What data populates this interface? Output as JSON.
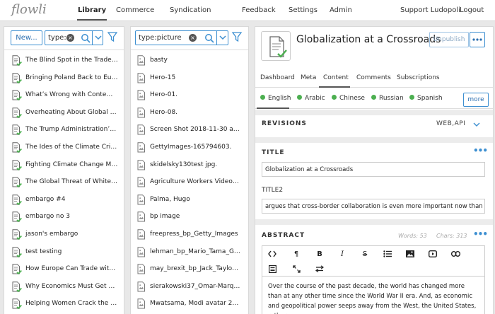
{
  "app": {
    "logo": "flowli"
  },
  "nav": {
    "items": [
      "Library",
      "Commerce",
      "Syndication",
      "Feedback",
      "Settings",
      "Admin"
    ],
    "active": "Library",
    "support": "Support Ludopoli",
    "logout": "Logout"
  },
  "col1": {
    "new_label": "New...",
    "search_tag": "type:a",
    "items": [
      "The Blind Spot in the Trade Debate",
      "Bringing Poland Back to Europe",
      "What’s Wrong with Contemporary Conservatism?",
      "Overheating About Global Warming",
      "The Trump Administration’s Failed Policies",
      "The Ides of the Climate Crisis",
      "Fighting Climate Change Means Fighting Inequality",
      "The Global Threat of White Terror",
      "embargo #4",
      "embargo no 3",
      "jason's embargo",
      "test testing",
      "How Europe Can Trade with Iran",
      "Why Economics Must Get Broader",
      "Helping Women Crack the “Expertise” Ceiling"
    ]
  },
  "col2": {
    "search_tag": "type:picture",
    "items": [
      "basty",
      "Hero-15",
      "Hero-01.",
      "Hero-08.",
      "Screen Shot 2018-11-30 at 11.22.45",
      "GettyImages-165794603.",
      "skidelsky130test jpg.",
      "Agriculture Workers Video_WebReady",
      "Palma, Hugo",
      "bp image",
      "freepress_bp_Getty_Images",
      "lehman_bp_Mario_Tama_Getty_Images",
      "may_brexit_bp_Jack_Taylor_Getty",
      "sierakowski37_Omar-Marques_Getty",
      "Mwatsama, Modi avatar 2019."
    ]
  },
  "detail": {
    "title": "Globalization at a Crossroads",
    "unpublish": "Unpublish",
    "tabs": [
      "Dashboard",
      "Meta",
      "Content",
      "Comments",
      "Subscriptions"
    ],
    "active_tab": "Content",
    "languages": [
      "English",
      "Arabic",
      "Chinese",
      "Russian",
      "Spanish"
    ],
    "active_language": "English",
    "more": "more",
    "revisions_label": "REVISIONS",
    "revisions_value": "WEB,API",
    "title_label": "TITLE",
    "title_value": "Globalization at a Crossroads",
    "title2_label": "TITLE2",
    "title2_value": "argues that cross-border collaboration is even more important now than after World War II",
    "abstract_label": "ABSTRACT",
    "words": "Words: 53",
    "chars": "Chars: 313",
    "abstract_text": "Over the course of the past decade, the world has changed more than at any other time since the World War II era. And, as economic and geopolitical power seeps away from the West, the United States, rather"
  },
  "colors": {
    "accent": "#3d8fd1",
    "status_green": "#4caf50"
  }
}
